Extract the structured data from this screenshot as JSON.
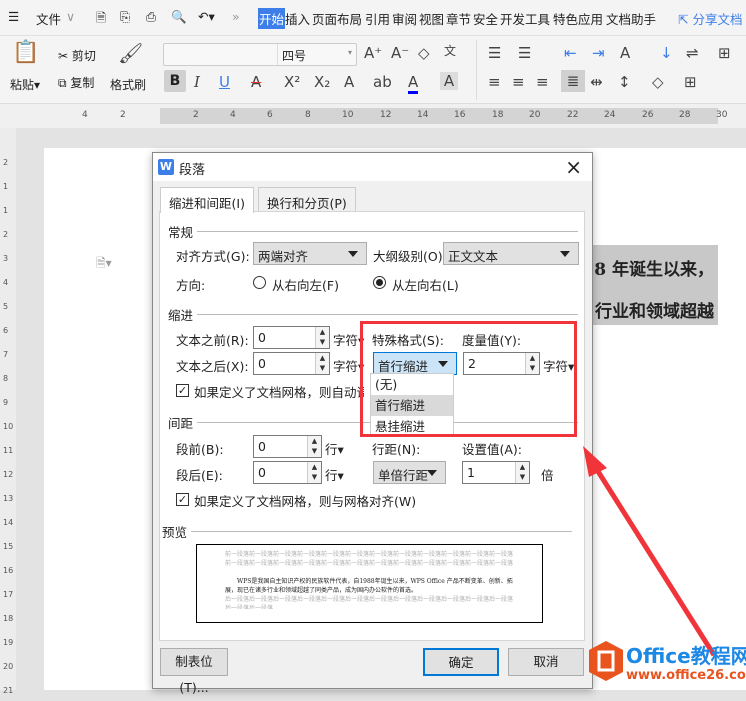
{
  "menubar": {
    "menu_icon": "hamburger-icon",
    "file": "文件",
    "tabs": [
      "开始",
      "插入",
      "页面布局",
      "引用",
      "审阅",
      "视图",
      "章节",
      "安全",
      "开发工具",
      "特色应用",
      "文档助手"
    ],
    "active_tab": "开始",
    "share": "分享文档"
  },
  "ribbon": {
    "paste": "粘贴",
    "cut": "剪切",
    "copy": "复制",
    "format_painter": "格式刷",
    "font_name": "",
    "font_size": "四号",
    "bold": "B",
    "italic": "I",
    "underline": "U",
    "accent": "#3d7ee8"
  },
  "ruler": {
    "ticks": [
      "4",
      "2",
      "2",
      "4",
      "6",
      "8",
      "10",
      "12",
      "14",
      "16",
      "18",
      "20",
      "22",
      "24",
      "26",
      "28",
      "30"
    ]
  },
  "vruler": {
    "ticks": [
      "2",
      "1",
      "1",
      "2",
      "3",
      "4",
      "5",
      "6",
      "7",
      "8",
      "9",
      "10",
      "11",
      "12",
      "13",
      "14",
      "15",
      "16",
      "17",
      "18",
      "19",
      "20",
      "21"
    ]
  },
  "document": {
    "line1": "8 年诞生以来，",
    "line2": "行业和领域超越"
  },
  "dialog": {
    "title": "段落",
    "close": "×",
    "tabs": [
      "缩进和间距(I)",
      "换行和分页(P)"
    ],
    "general": {
      "heading": "常规",
      "align_label": "对齐方式(G):",
      "align_value": "两端对齐",
      "outline_label": "大纲级别(O):",
      "outline_value": "正文文本",
      "direction_label": "方向:",
      "rtl": "从右向左(F)",
      "ltr": "从左向右(L)",
      "direction_selected": "从左向右(L)"
    },
    "indent": {
      "heading": "缩进",
      "before_label": "文本之前(R):",
      "before_value": "0",
      "before_unit": "字符▾",
      "after_label": "文本之后(X):",
      "after_value": "0",
      "after_unit": "字符▾",
      "special_label": "特殊格式(S):",
      "special_value": "首行缩进",
      "measure_label": "度量值(Y):",
      "measure_value": "2",
      "measure_unit": "字符▾",
      "grid_check": "如果定义了文档网格，则自动调整",
      "grid_checked": true,
      "special_options": [
        "(无)",
        "首行缩进",
        "悬挂缩进"
      ],
      "special_hover": "首行缩进"
    },
    "spacing": {
      "heading": "间距",
      "before_label": "段前(B):",
      "before_value": "0",
      "before_unit": "行▾",
      "after_label": "段后(E):",
      "after_value": "0",
      "after_unit": "行▾",
      "line_label": "行距(N):",
      "line_value": "单倍行距",
      "set_label": "设置值(A):",
      "set_value": "1",
      "set_unit": "倍",
      "grid_check": "如果定义了文档网格，则与网格对齐(W)",
      "grid_checked": true
    },
    "preview": {
      "heading": "预览",
      "before": "前一段落前一段落前一段落前一段落前一段落前一段落前一段落前一段落前一段落前一段落前一段落前一段落前一段落前一段落前一段落前一段落前一段落前一段落前一段落前一段落前一段落前一段落前一段落前一段落",
      "body": "WPS是我国自主知识产权的民族软件代表，自1988年诞生以来，WPS Office 产品不断变革、创新、拓展，现已在诸多行业和领域超越了同类产品，成为国内办公软件的首选。",
      "after": "后一段落后一段落后一段落后一段落后一段落后一段落后一段落后一段落后一段落后一段落后一段落后一段落后一段落后一段落"
    },
    "buttons": {
      "tabs": "制表位(T)...",
      "ok": "确定",
      "cancel": "取消"
    }
  },
  "annotation": {
    "color": "#f0343a"
  },
  "watermark": {
    "name": "Office教程网",
    "url": "www.office26.com",
    "color": "#e8531e"
  }
}
